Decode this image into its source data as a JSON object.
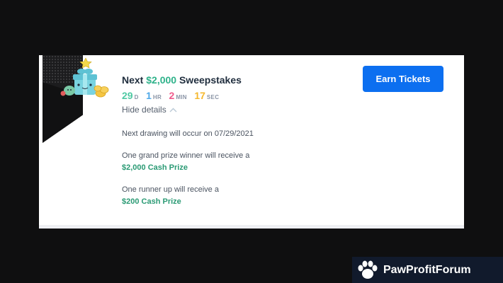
{
  "sweepstakes": {
    "title_prefix": "Next",
    "title_amount": "$2,000",
    "title_suffix": "Sweepstakes",
    "countdown": [
      {
        "value": "29",
        "unit": "D",
        "color": "#4fc9a3"
      },
      {
        "value": "1",
        "unit": "HR",
        "color": "#4fa9e8"
      },
      {
        "value": "2",
        "unit": "MIN",
        "color": "#f05a8c"
      },
      {
        "value": "17",
        "unit": "SEC",
        "color": "#f5b82e"
      }
    ],
    "hide_details_label": "Hide details",
    "drawing_text": "Next drawing will occur on 07/29/2021",
    "grand_prize_text": "One grand prize winner will receive a",
    "grand_prize_amount": "$2,000 Cash Prize",
    "runner_up_text": "One runner up will receive a",
    "runner_up_amount": "$200 Cash Prize",
    "earn_button_label": "Earn Tickets"
  },
  "watermark": {
    "text": "PawProfitForum",
    "icon": "paw-icon"
  },
  "colors": {
    "accent_green": "#2eb28a",
    "button_blue": "#0c6ff0",
    "background": "#0f0f10"
  }
}
